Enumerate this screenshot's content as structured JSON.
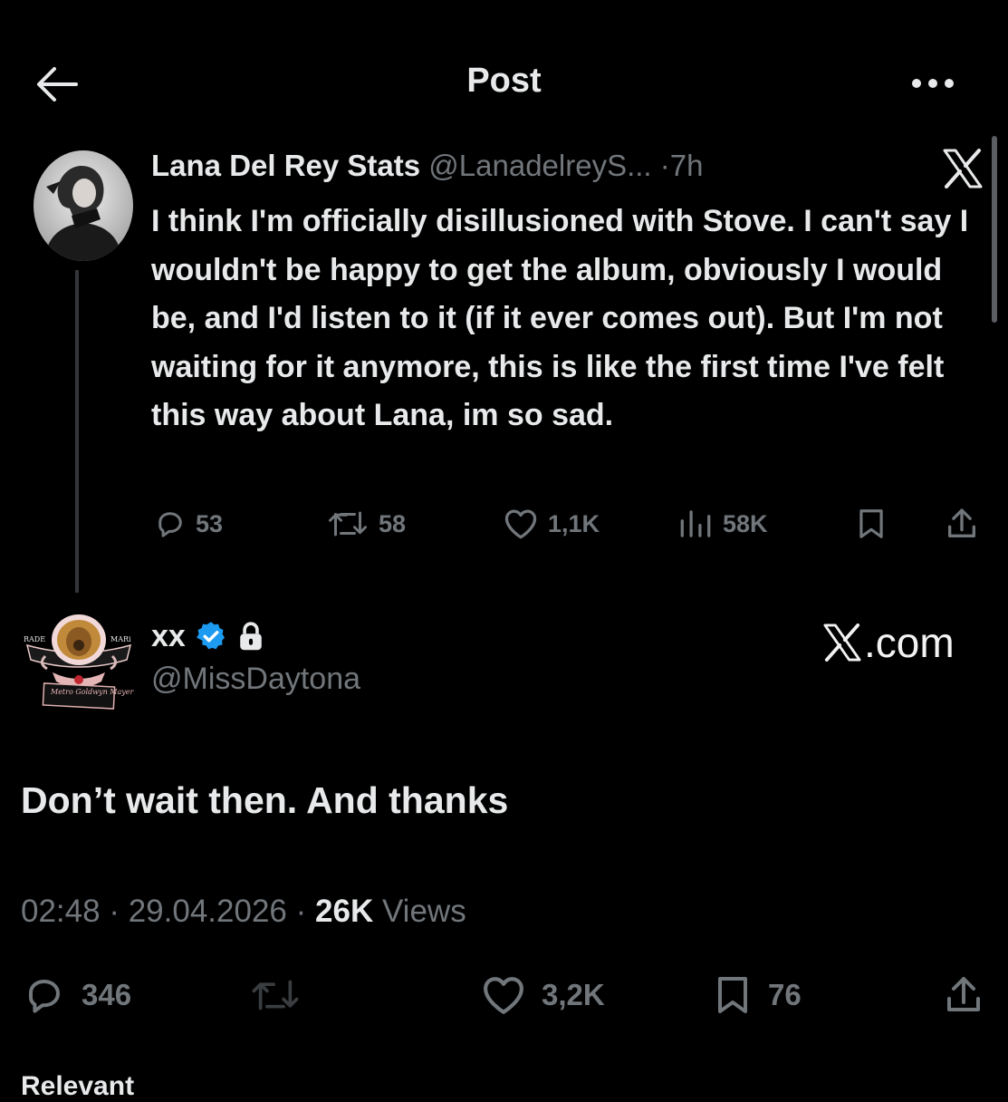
{
  "header": {
    "title": "Post",
    "back_icon": "arrow-left-icon",
    "more_icon": "more-horizontal-icon"
  },
  "quoted_post": {
    "author_name": "Lana Del Rey Stats",
    "handle": "@LanadelreyS...",
    "separator": "·",
    "time": "7h",
    "text": "I think I'm officially disillusioned with Stove. I can't say I wouldn't be happy to get the album, obviously I would be, and I'd listen to it (if it ever comes out). But I'm not waiting for it anymore, this is like the first time I've felt this way about Lana, im so sad.",
    "actions": {
      "replies": "53",
      "reposts": "58",
      "likes": "1,1K",
      "views": "58K"
    }
  },
  "main_post": {
    "author_name": "xx",
    "handle": "@MissDaytona",
    "verified": true,
    "protected": true,
    "watermark": ".com",
    "avatar_text": {
      "left": "RADE",
      "right": "MARi",
      "banner": "Metro Goldwyn Mayer"
    },
    "text": "Don’t wait then. And thanks",
    "time": "02:48",
    "separator1": "·",
    "date": "29.04.2026",
    "separator2": "·",
    "views_count": "26K",
    "views_label": "Views",
    "actions": {
      "replies": "346",
      "likes": "3,2K",
      "bookmarks": "76"
    }
  },
  "footer": {
    "section_label": "Relevant"
  },
  "colors": {
    "background": "#000000",
    "text_primary": "#e7e9ea",
    "text_secondary": "#71767b",
    "verified_blue": "#1d9bf0"
  }
}
